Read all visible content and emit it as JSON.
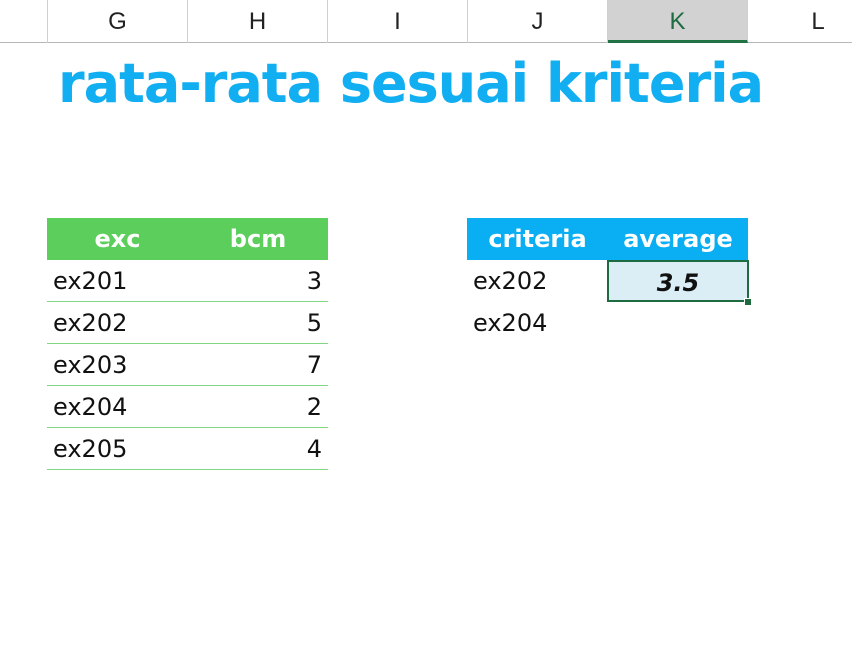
{
  "column_headers": [
    "G",
    "H",
    "I",
    "J",
    "K",
    "L"
  ],
  "selected_column": "K",
  "title": "rata-rata sesuai kriteria",
  "source_table": {
    "headers": [
      "exc",
      "bcm"
    ],
    "rows": [
      {
        "exc": "ex201",
        "bcm": "3"
      },
      {
        "exc": "ex202",
        "bcm": "5"
      },
      {
        "exc": "ex203",
        "bcm": "7"
      },
      {
        "exc": "ex204",
        "bcm": "2"
      },
      {
        "exc": "ex205",
        "bcm": "4"
      }
    ]
  },
  "criteria_table": {
    "headers": [
      "criteria",
      "average"
    ],
    "rows": [
      {
        "criteria": "ex202",
        "average": "3.5"
      },
      {
        "criteria": "ex204",
        "average": ""
      }
    ]
  },
  "colors": {
    "title": "#12aef2",
    "source_header": "#5cce5c",
    "criteria_header": "#0aaef2",
    "active_cell_fill": "#dbeef5",
    "selection_border": "#1e6b41"
  }
}
